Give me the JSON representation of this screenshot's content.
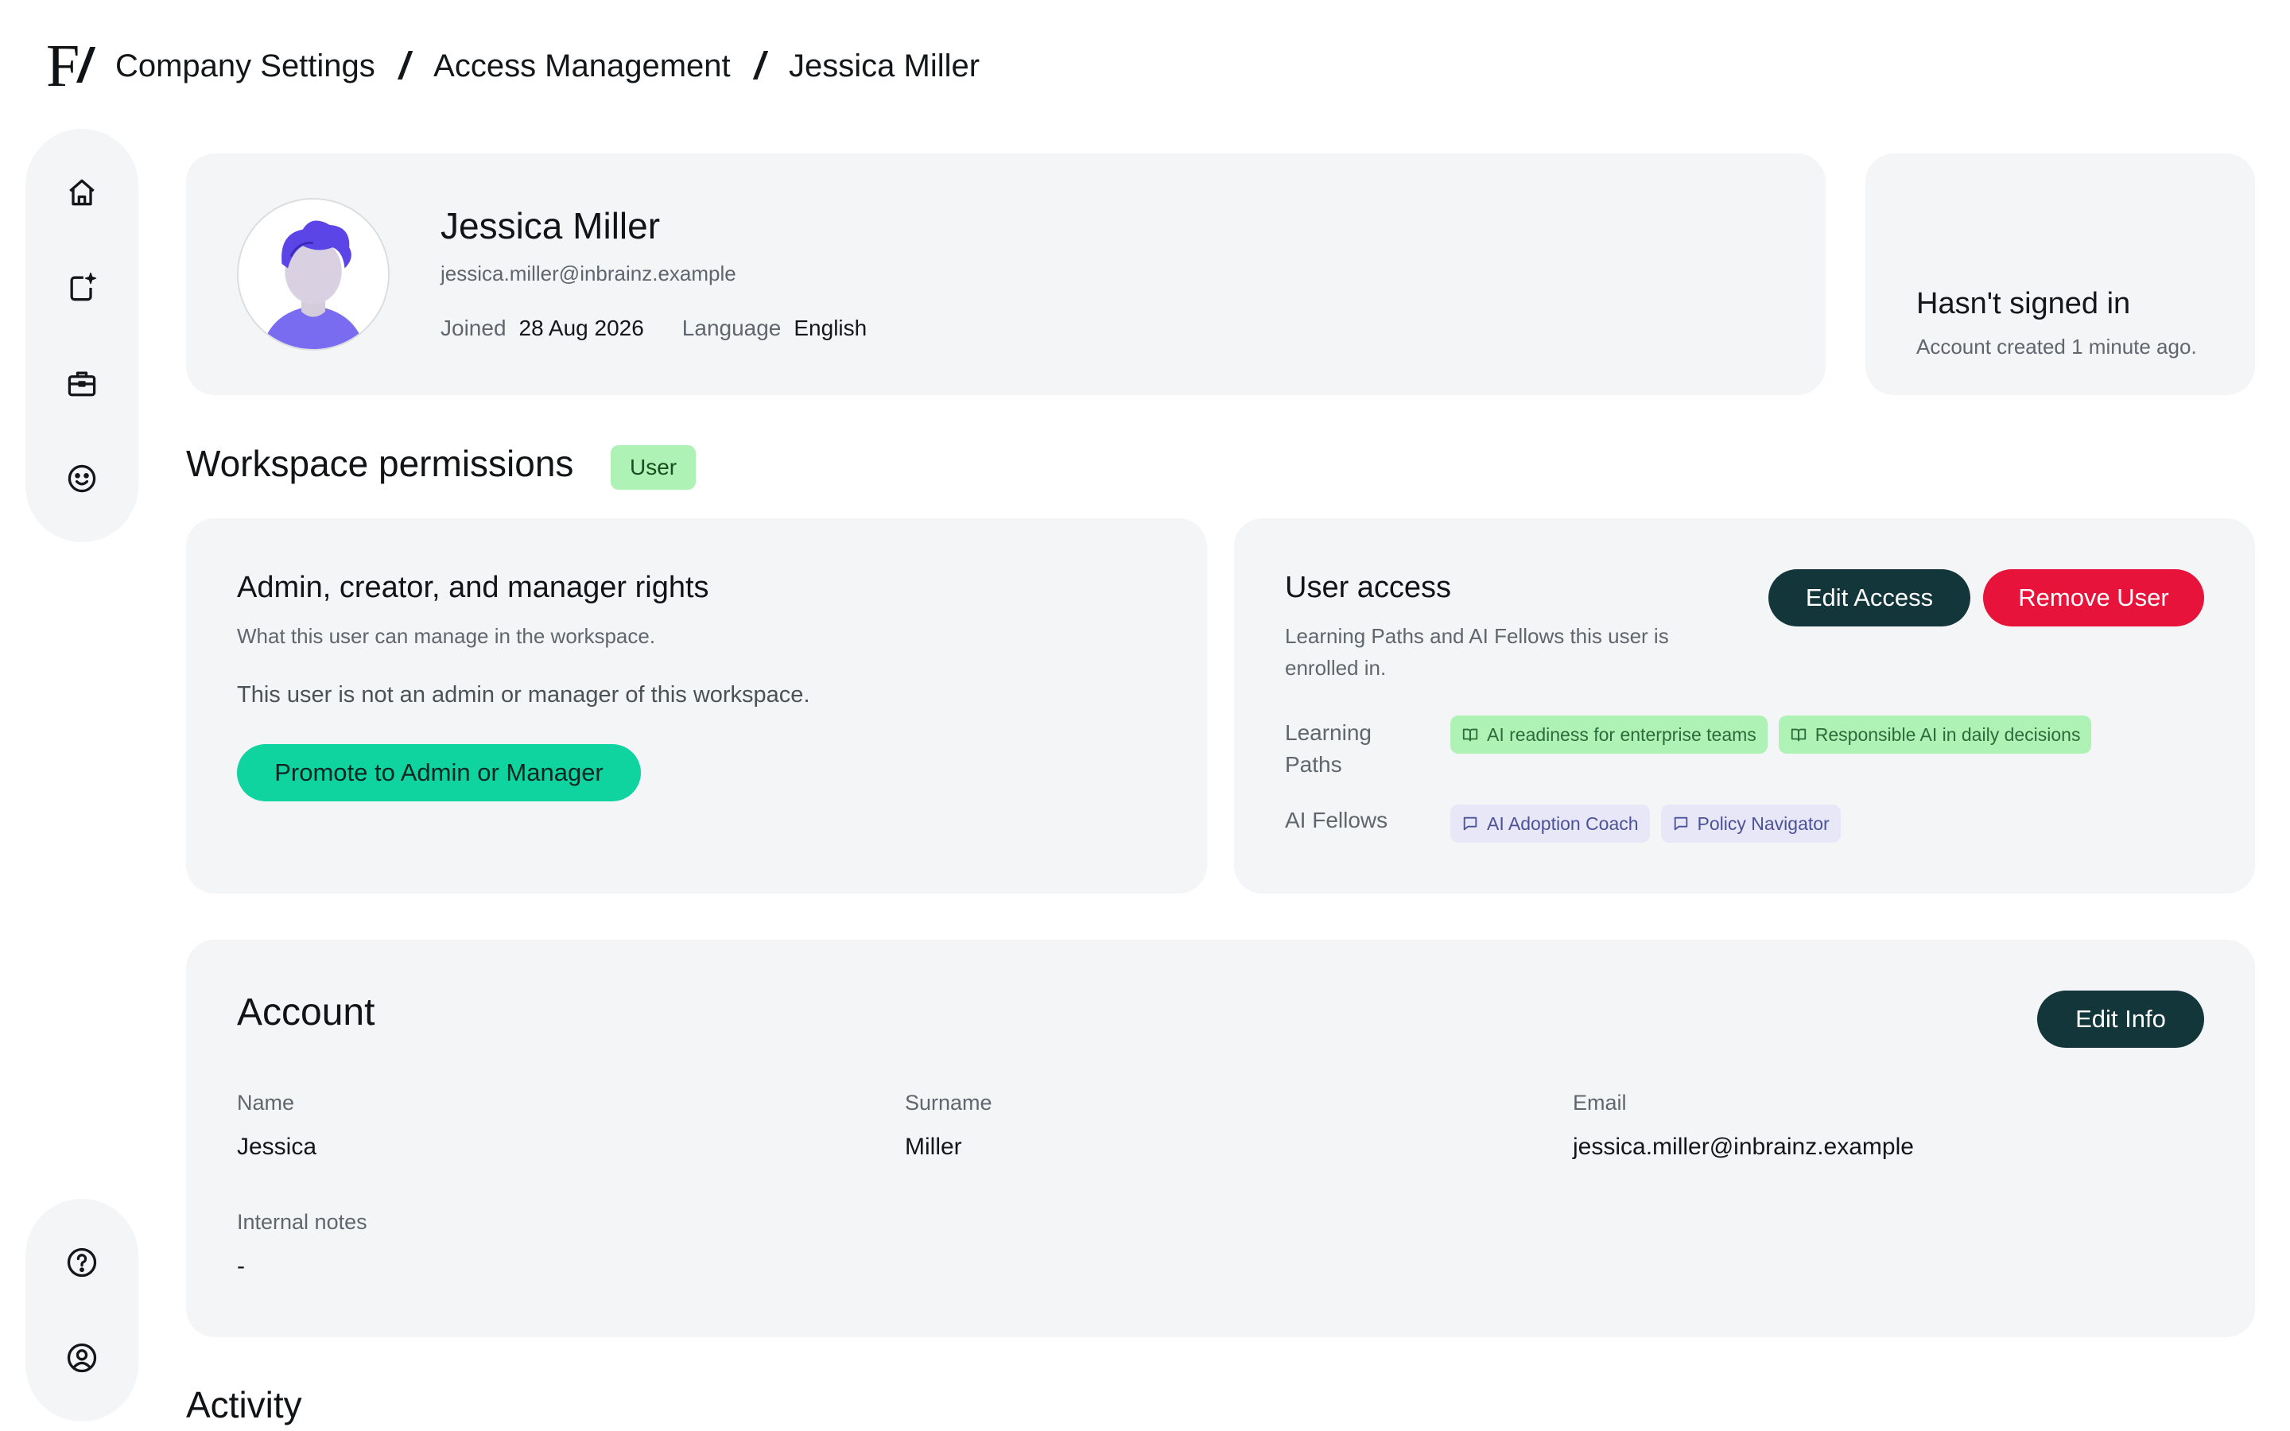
{
  "breadcrumb": {
    "logo_main": "F",
    "logo_slash": "/",
    "separator": "/",
    "items": [
      "Company Settings",
      "Access Management",
      "Jessica Miller"
    ]
  },
  "nav": {
    "top": [
      {
        "icon": "home-icon"
      },
      {
        "icon": "sparkle-document-icon"
      },
      {
        "icon": "briefcase-icon"
      },
      {
        "icon": "smiley-icon"
      }
    ],
    "bottom": [
      {
        "icon": "help-circle-icon"
      },
      {
        "icon": "user-circle-icon"
      }
    ]
  },
  "profile": {
    "name": "Jessica Miller",
    "email": "jessica.miller@inbrainz.example",
    "joined_label": "Joined",
    "joined_value": "28 Aug 2026",
    "language_label": "Language",
    "language_value": "English"
  },
  "signin": {
    "status": "Hasn't signed in",
    "note": "Account created 1 minute ago."
  },
  "workspace": {
    "title": "Workspace permissions",
    "role_badge": "User",
    "rights": {
      "title": "Admin, creator, and manager rights",
      "subtitle": "What this user can manage in the workspace.",
      "note": "This user is not an admin or manager of this workspace.",
      "promote_label": "Promote to Admin or Manager"
    },
    "access": {
      "title": "User access",
      "subtitle": "Learning Paths and AI Fellows this user is enrolled in.",
      "edit_label": "Edit Access",
      "remove_label": "Remove User",
      "learning_paths_label": "Learning Paths",
      "learning_paths": [
        "AI readiness for enterprise teams",
        "Responsible AI in daily decisions"
      ],
      "ai_fellows_label": "AI Fellows",
      "ai_fellows": [
        "AI Adoption Coach",
        "Policy Navigator"
      ]
    }
  },
  "account": {
    "title": "Account",
    "edit_label": "Edit Info",
    "name_label": "Name",
    "name_value": "Jessica",
    "surname_label": "Surname",
    "surname_value": "Miller",
    "email_label": "Email",
    "email_value": "jessica.miller@inbrainz.example",
    "notes_label": "Internal notes",
    "notes_value": "-"
  },
  "activity": {
    "title": "Activity"
  },
  "colors": {
    "panel": "#f4f5f6",
    "dark_button": "#12363a",
    "danger": "#e8133a",
    "promote": "#10d4a0",
    "badge_green": "#aef2b6",
    "chip_purple": "#e7e7f7"
  }
}
